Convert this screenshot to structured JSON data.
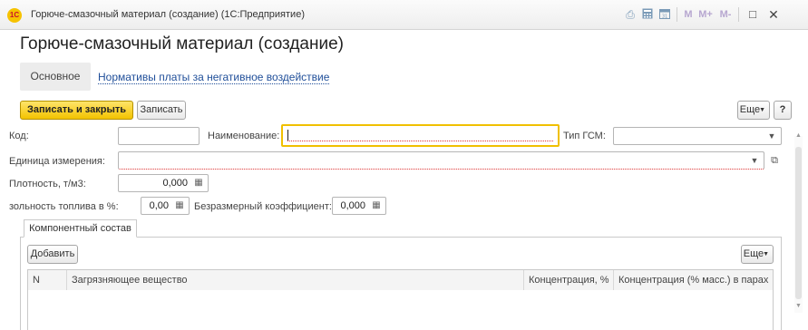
{
  "window": {
    "logo_text": "1С",
    "title": "Горюче-смазочный материал (создание)  (1С:Предприятие)",
    "buttons": {
      "m": "M",
      "m_plus": "M+",
      "m_minus": "M-",
      "restore": "□",
      "close": "✕"
    }
  },
  "form": {
    "title": "Горюче-смазочный материал (создание)",
    "tabs": [
      {
        "label": "Основное"
      },
      {
        "label": "Нормативы платы за негативное воздействие"
      }
    ]
  },
  "toolbar": {
    "save_close_label": "Записать и закрыть",
    "save_label": "Записать",
    "more_label": "Еще",
    "help_label": "?"
  },
  "fields": {
    "code_label": "Код:",
    "code_value": "",
    "name_label": "Наименование:",
    "name_value": "",
    "gsm_type_label": "Тип ГСМ:",
    "gsm_type_value": "",
    "unit_label": "Единица измерения:",
    "unit_value": "",
    "density_label": "Плотность, т/м3:",
    "density_value": "0,000",
    "ash_label": "зольность топлива в %:",
    "ash_value": "0,00",
    "coef_label": "Безразмерный коэффициент:",
    "coef_value": "0,000"
  },
  "components": {
    "tab_label": "Компонентный состав",
    "add_label": "Добавить",
    "more_label": "Еще",
    "columns": [
      "N",
      "Загрязняющее вещество",
      "Концентрация, %",
      "Концентрация (% масс.) в парах"
    ],
    "rows": []
  }
}
